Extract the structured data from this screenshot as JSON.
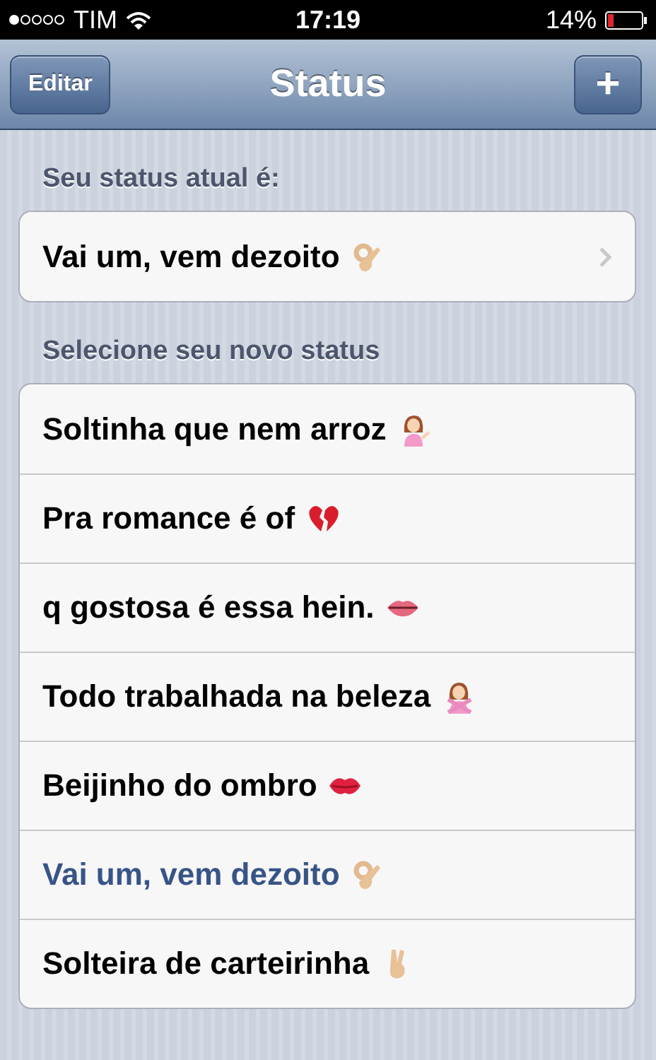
{
  "status_bar": {
    "carrier": "TIM",
    "time": "17:19",
    "battery": "14%"
  },
  "nav_bar": {
    "left_button": "Editar",
    "title": "Status",
    "right_button": "+"
  },
  "current_status": {
    "header": "Seu status atual é:",
    "item": {
      "text": "Vai um, vem dezoito",
      "kind": "ok-hand"
    }
  },
  "new_status": {
    "header": "Selecione seu novo status",
    "items": [
      {
        "text": "Soltinha que nem arroz",
        "kind": "person-tipping",
        "selected": false
      },
      {
        "text": "Pra romance é of",
        "kind": "broken-heart",
        "selected": false
      },
      {
        "text": "q gostosa é essa hein.",
        "kind": "lips",
        "selected": false
      },
      {
        "text": "Todo trabalhada na beleza",
        "kind": "person-crossing",
        "selected": false
      },
      {
        "text": "Beijinho do ombro",
        "kind": "kiss",
        "selected": false
      },
      {
        "text": "Vai um, vem dezoito",
        "kind": "ok-hand",
        "selected": true
      },
      {
        "text": "Solteira de carteirinha",
        "kind": "victory-hand",
        "selected": false
      }
    ]
  }
}
